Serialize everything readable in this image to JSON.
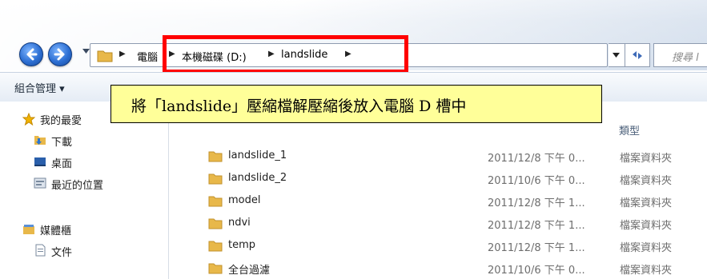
{
  "addressbar": {
    "crumbs": [
      "電腦",
      "本機磁碟 (D:)",
      "landslide"
    ],
    "search_placeholder": "搜尋 l"
  },
  "toolbar": {
    "organize_label": "組合管理 ▾"
  },
  "callout": {
    "text": "將「landslide」壓縮檔解壓縮後放入電腦 D 槽中"
  },
  "sidebar": {
    "items": [
      {
        "label": "我的最愛",
        "icon": "star-icon"
      },
      {
        "label": "下載",
        "icon": "download-folder-icon"
      },
      {
        "label": "桌面",
        "icon": "desktop-icon"
      },
      {
        "label": "最近的位置",
        "icon": "recent-places-icon"
      },
      {
        "label": "媒體櫃",
        "icon": "library-icon"
      },
      {
        "label": "文件",
        "icon": "documents-icon"
      }
    ]
  },
  "columns": {
    "type": "類型"
  },
  "files": [
    {
      "name": "landslide_1",
      "date": "2011/12/8 下午 0...",
      "type": "檔案資料夾"
    },
    {
      "name": "landslide_2",
      "date": "2011/10/6 下午 0...",
      "type": "檔案資料夾"
    },
    {
      "name": "model",
      "date": "2011/12/8 下午 1...",
      "type": "檔案資料夾"
    },
    {
      "name": "ndvi",
      "date": "2011/12/8 下午 1...",
      "type": "檔案資料夾"
    },
    {
      "name": "temp",
      "date": "2011/12/8 下午 1...",
      "type": "檔案資料夾"
    },
    {
      "name": "全台過濾",
      "date": "2011/10/6 下午 0...",
      "type": "檔案資料夾"
    }
  ],
  "colors": {
    "callout_bg": "#ffff99",
    "highlight_border": "#ff0000"
  }
}
